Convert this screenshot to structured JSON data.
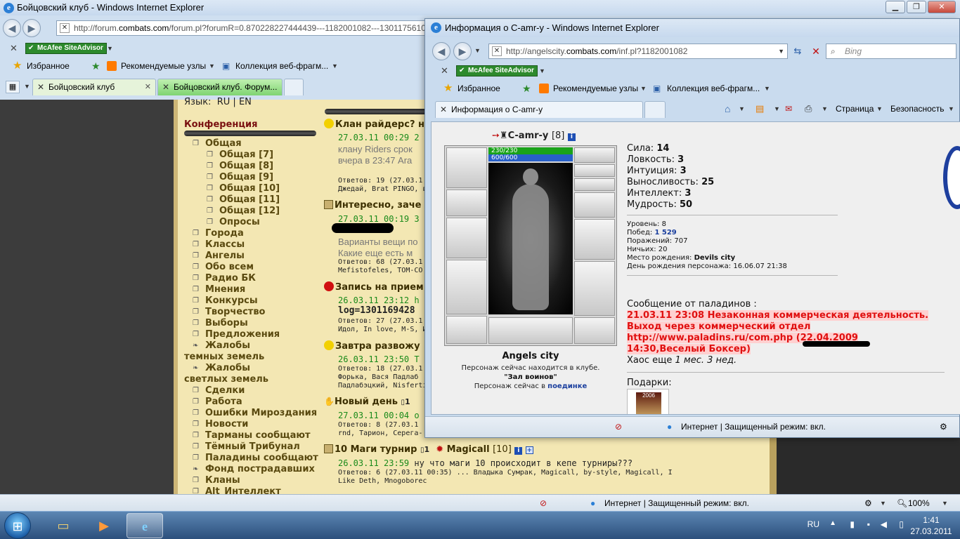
{
  "main": {
    "title": "Бойцовский клуб - Windows Internet Explorer",
    "url_prefix": "http://forum.",
    "url_domain": "combats.com",
    "url_rest": "/forum.pl?forumR=0.870228227444439---1182001082---1301175610",
    "favorites": "Избранное",
    "recommended": "Рекомендуемые узлы",
    "gallery": "Коллекция веб-фрагм...",
    "mcafee": "McAfee SiteAdvisor",
    "tabs": [
      "Бойцовский клуб",
      "Бойцовский клуб. Форум..."
    ],
    "status_zone": "Интернет | Защищенный режим: вкл.",
    "zoom": "100%"
  },
  "forum": {
    "lang_label": "Язык:",
    "lang_ru": "RU",
    "lang_sep": "|",
    "lang_en": "EN",
    "conference": "Конференция",
    "items": [
      {
        "label": "Общая",
        "indent": 1
      },
      {
        "label": "Общая [7]",
        "indent": 2
      },
      {
        "label": "Общая [8]",
        "indent": 2
      },
      {
        "label": "Общая [9]",
        "indent": 2
      },
      {
        "label": "Общая [10]",
        "indent": 2
      },
      {
        "label": "Общая [11]",
        "indent": 2
      },
      {
        "label": "Общая [12]",
        "indent": 2
      },
      {
        "label": "Опросы",
        "indent": 2
      },
      {
        "label": "Города",
        "indent": 1
      },
      {
        "label": "Классы",
        "indent": 1
      },
      {
        "label": "Ангелы",
        "indent": 1
      },
      {
        "label": "Обо всем",
        "indent": 1
      },
      {
        "label": "Радио БК",
        "indent": 1
      },
      {
        "label": "Мнения",
        "indent": 1
      },
      {
        "label": "Конкурсы",
        "indent": 1
      },
      {
        "label": "Творчество",
        "indent": 1
      },
      {
        "label": "Выборы",
        "indent": 1
      },
      {
        "label": "Предложения",
        "indent": 1
      },
      {
        "label": "Жалобы",
        "indent": 1
      },
      {
        "label": "темных земель",
        "indent": 0
      },
      {
        "label": "Жалобы",
        "indent": 1
      },
      {
        "label": "светлых земель",
        "indent": 0
      },
      {
        "label": "Сделки",
        "indent": 1
      },
      {
        "label": "Работа",
        "indent": 1
      },
      {
        "label": "Ошибки Мироздания",
        "indent": 1
      },
      {
        "label": "Новости",
        "indent": 1
      },
      {
        "label": "Тарманы сообщают",
        "indent": 1
      },
      {
        "label": "Тёмный Трибунал",
        "indent": 1
      },
      {
        "label": "Паладины сообщают",
        "indent": 1
      },
      {
        "label": "Фонд пострадавших",
        "indent": 1
      },
      {
        "label": "Кланы",
        "indent": 1
      },
      {
        "label": "Alt_Интеллект",
        "indent": 1
      }
    ],
    "topics": [
      {
        "title": "Клан райдерс? не",
        "date": "27.03.11 00:29 2",
        "line1": "клану Riders срок",
        "line2": "вчера в 23:47 Ara",
        "replies": "Ответов: 19  (27.03.1",
        "authors": "Джедай, Brat PINGO, в"
      },
      {
        "title": "Интересно, заче",
        "date": "27.03.11 00:19 3",
        "line1": "Варианты вещи по",
        "line2": "Какие еще есть м",
        "replies": "Ответов: 68  (27.03.1",
        "authors": "Mefistofeles, TOM-CO"
      },
      {
        "title": "Запись на прием",
        "date": "26.03.11 23:12 h",
        "line1": "log=1301169428",
        "line2": "",
        "replies": "Ответов: 27  (27.03.1",
        "authors": "Идол, In love, M-S, Ид"
      },
      {
        "title": "Завтра развожу",
        "date": "26.03.11 23:50 Т",
        "line1": "",
        "line2": "",
        "replies": "Ответов: 18  (27.03.1",
        "authors": "Форька, Вася Падлаб",
        "authors2": "Падлабэцкий, Nisferti"
      },
      {
        "title": "Новый день",
        "pages": "1",
        "date": "27.03.11 00:04 о",
        "replies": "Ответов: 8   (27.03.1",
        "authors": "rnd, Тарион, Серега-"
      },
      {
        "title": "10 Маги турнир",
        "pages": "1",
        "author": "Magicall",
        "author_level": "[10]",
        "date": "26.03.11 23:59",
        "text": "ну что маги 10 происходит в кепе турниры???",
        "replies": "Ответов: 6  (27.03.11 00:35) ... Владыка Сумрак, Magicall, by-style, Magicall, I",
        "authors": "Like Deth, Mnogoborec"
      }
    ]
  },
  "popup": {
    "title": "Информация о C-amr-y - Windows Internet Explorer",
    "url_prefix": "http://angelscity.",
    "url_domain": "combats.com",
    "url_rest": "/inf.pl?1182001082",
    "search_placeholder": "Bing",
    "favorites": "Избранное",
    "recommended": "Рекомендуемые узлы",
    "gallery": "Коллекция веб-фрагм...",
    "mcafee": "McAfee SiteAdvisor",
    "tab": "Информация о C-amr-y",
    "page_menu": "Страница",
    "security_menu": "Безопасность",
    "status_zone": "Интернет | Защищенный режим: вкл.",
    "character": {
      "name": "C-amr-y",
      "level": "[8]",
      "hp": "230/230",
      "mp": "600/600",
      "city": "Angels city",
      "location_line": "Персонаж сейчас находится в клубе.",
      "room": "\"Зал воинов\"",
      "status_prefix": "Персонаж сейчас в",
      "status_link": "поединке"
    },
    "stats": [
      {
        "label": "Сила:",
        "value": "14"
      },
      {
        "label": "Ловкость:",
        "value": "3"
      },
      {
        "label": "Интуиция:",
        "value": "3"
      },
      {
        "label": "Выносливость:",
        "value": "25"
      },
      {
        "label": "Интеллект:",
        "value": "3"
      },
      {
        "label": "Мудрость:",
        "value": "50"
      }
    ],
    "details": {
      "level": "Уровень: 8",
      "wins_label": "Побед:",
      "wins": "1 529",
      "losses": "Поражений: 707",
      "draws": "Ничьих: 20",
      "birthplace_label": "Место рождения:",
      "birthplace": "Devils city",
      "birthday": "День рождения персонажа: 16.06.07 21:38"
    },
    "message_head": "Сообщение от паладинов :",
    "message_lines": [
      "21.03.11 23:08 Незаконная коммерческая деятельность.",
      "Выход через коммерческий отдел",
      "http://www.paladins.ru/com.php (22.04.2009",
      "14:30,Веселый Боксер)"
    ],
    "chaos_prefix": "Хаос еще",
    "chaos_time": "1 мес. 3 нед.",
    "gifts_label": "Подарки:",
    "gift_year": "2006"
  },
  "taskbar": {
    "lang": "RU",
    "time": "1:41",
    "date": "27.03.2011"
  }
}
